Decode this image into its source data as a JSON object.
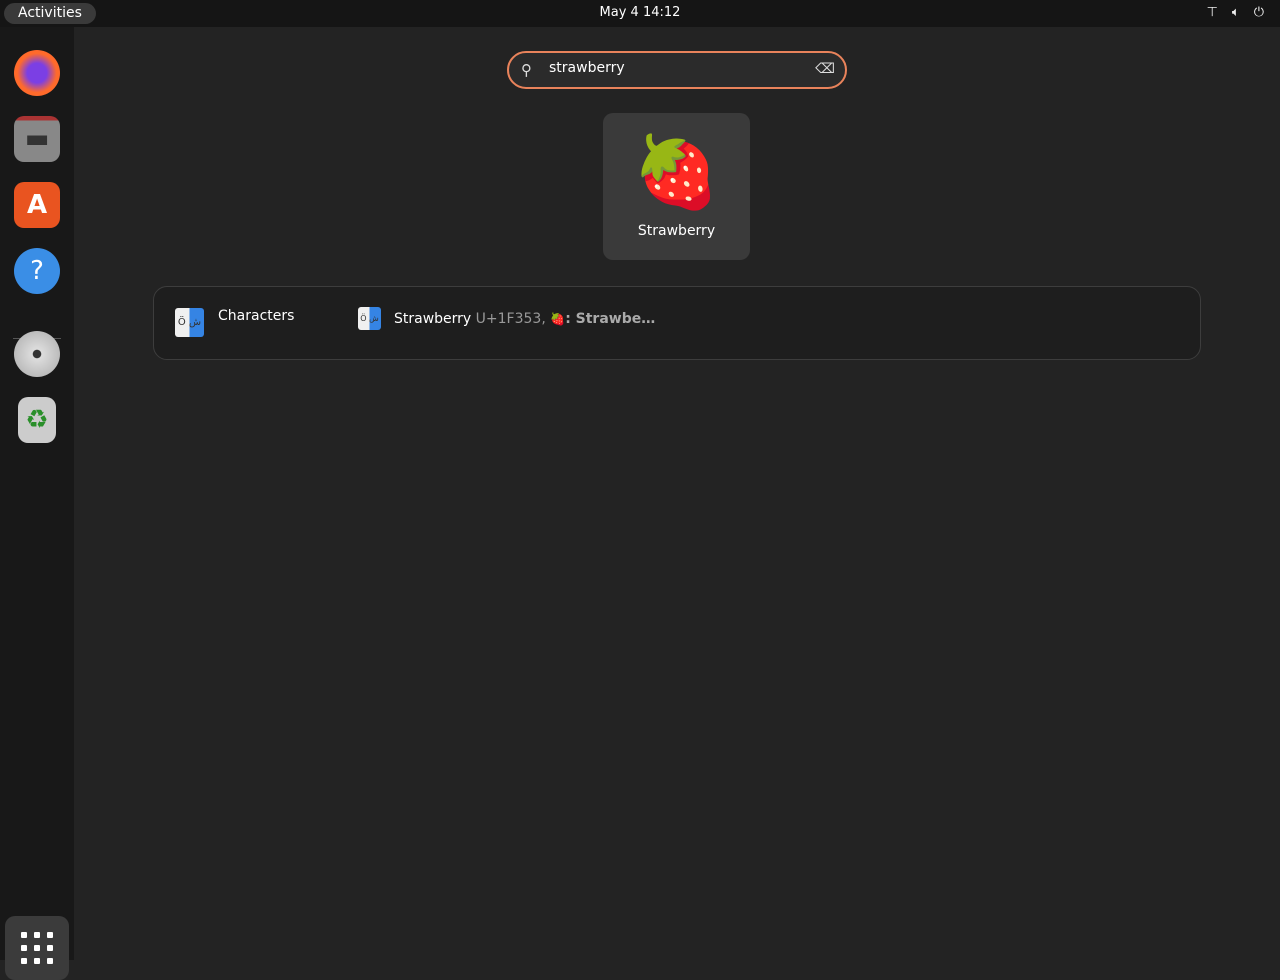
{
  "topbar": {
    "activities": "Activities",
    "clock": "May 4  14:12",
    "tray_icons": [
      "network-icon",
      "volume-icon",
      "power-icon"
    ]
  },
  "dock": {
    "items": [
      {
        "name": "firefox",
        "icon": "🦊"
      },
      {
        "name": "files",
        "icon": "🗂"
      },
      {
        "name": "app-center",
        "icon": "A"
      },
      {
        "name": "help",
        "icon": "?"
      },
      {
        "name": "dvd",
        "icon": "💿"
      },
      {
        "name": "trash",
        "icon": "♻"
      }
    ]
  },
  "search": {
    "value": "strawberry"
  },
  "app_result": {
    "label": "Strawberry",
    "icon": "🍓"
  },
  "provider": {
    "name": "Characters",
    "result_name": "Strawberry",
    "result_code": "U+1F353,",
    "result_emoji": "🍓",
    "result_desc": ": Strawbe…"
  }
}
